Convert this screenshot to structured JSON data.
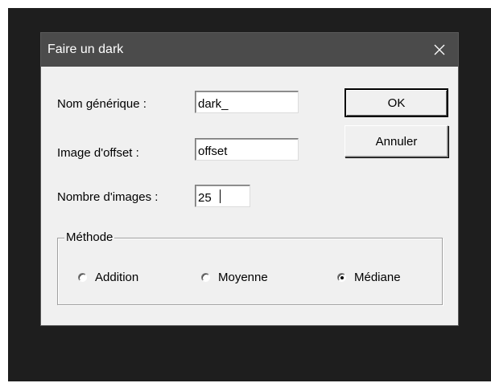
{
  "window": {
    "title": "Faire un dark",
    "close_icon": "close-icon"
  },
  "form": {
    "generic_name_label": "Nom générique :",
    "generic_name_value": "dark_",
    "offset_label": "Image d'offset :",
    "offset_value": "offset",
    "count_label": "Nombre d'images :",
    "count_value": "25"
  },
  "buttons": {
    "ok": "OK",
    "cancel": "Annuler"
  },
  "method": {
    "legend": "Méthode",
    "options": [
      {
        "label": "Addition",
        "checked": false
      },
      {
        "label": "Moyenne",
        "checked": false
      },
      {
        "label": "Médiane",
        "checked": true
      }
    ]
  },
  "colors": {
    "titlebar": "#4b4b4b",
    "dialog": "#f0f0f0",
    "desktop": "#1e1e1e"
  }
}
